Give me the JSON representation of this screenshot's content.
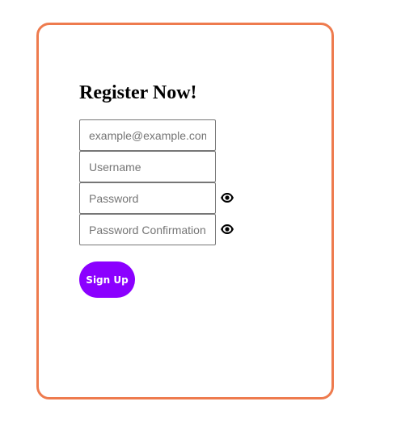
{
  "form": {
    "title": "Register Now!",
    "email_placeholder": "example@example.com",
    "username_placeholder": "Username",
    "password_placeholder": "Password",
    "password_confirmation_placeholder": "Password Confirmation",
    "submit_label": "Sign Up",
    "icons": {
      "password_toggle": "eye-icon",
      "password_confirmation_toggle": "eye-icon"
    }
  },
  "colors": {
    "card_border": "#ee7b4e",
    "button_background": "#8b00ff",
    "button_text": "#ffffff"
  }
}
